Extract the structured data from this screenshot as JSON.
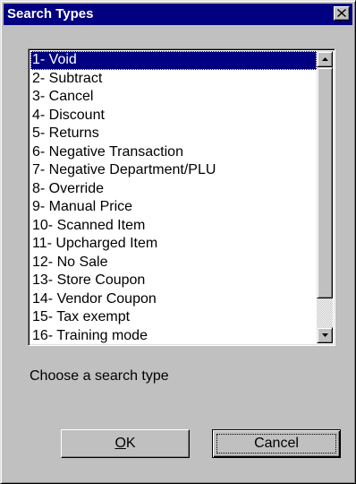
{
  "window": {
    "title": "Search Types",
    "close_icon": "close-x-icon"
  },
  "list": {
    "selected_index": 0,
    "items": [
      "1- Void",
      "2- Subtract",
      "3- Cancel",
      "4- Discount",
      "5- Returns",
      "6- Negative Transaction",
      "7- Negative Department/PLU",
      "8- Override",
      "9- Manual Price",
      "10- Scanned Item",
      "11- Upcharged Item",
      "12- No Sale",
      "13- Store Coupon",
      "14- Vendor Coupon",
      "15- Tax exempt",
      "16- Training mode"
    ],
    "scroll_position": 0.0,
    "visible_fraction": 0.89,
    "scroll_up_icon": "triangle-up-icon",
    "scroll_down_icon": "triangle-down-icon"
  },
  "prompt": "Choose a search type",
  "buttons": {
    "ok_accel": "O",
    "ok_rest": "K",
    "cancel_label": "Cancel"
  },
  "colors": {
    "face": "#c0c0c0",
    "titlebar": "#000080",
    "selection": "#000080"
  }
}
